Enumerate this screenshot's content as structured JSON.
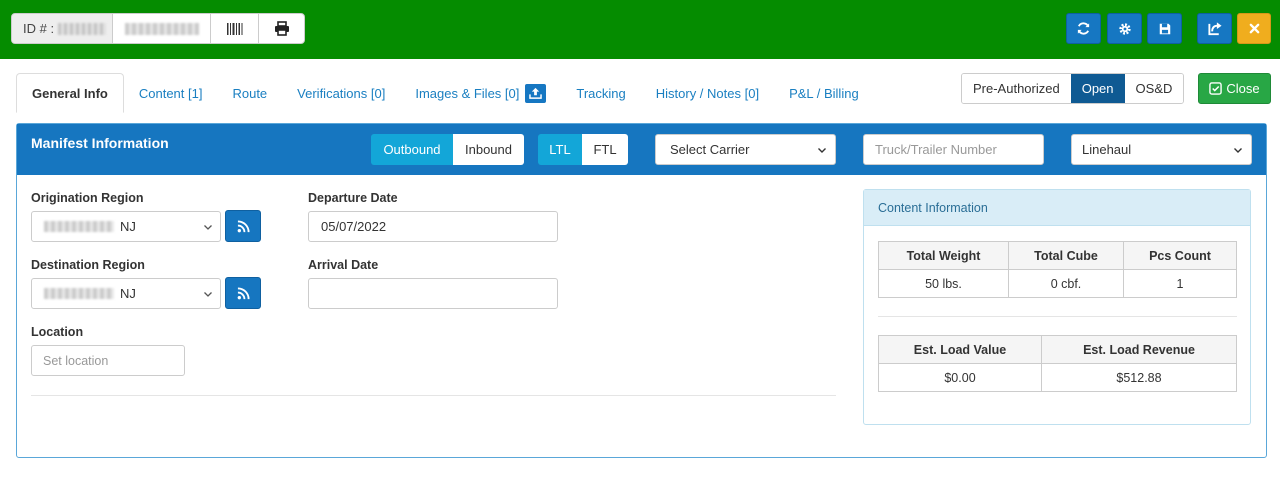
{
  "header": {
    "id_label": "ID # :",
    "buttons": [
      "refresh-icon",
      "gear-icon",
      "save-icon",
      "share-icon",
      "close-icon"
    ]
  },
  "tabs": [
    {
      "label": "General Info",
      "active": true
    },
    {
      "label": "Content [1]"
    },
    {
      "label": "Route"
    },
    {
      "label": "Verifications [0]"
    },
    {
      "label": "Images & Files [0]"
    },
    {
      "label": "Tracking"
    },
    {
      "label": "History / Notes [0]"
    },
    {
      "label": "P&L / Billing"
    }
  ],
  "status": {
    "options": [
      "Pre-Authorized",
      "Open",
      "OS&D"
    ],
    "selected": "Open",
    "close_label": "Close"
  },
  "manifest": {
    "title": "Manifest Information",
    "direction": {
      "options": [
        "Outbound",
        "Inbound"
      ],
      "selected": "Outbound"
    },
    "load_type": {
      "options": [
        "LTL",
        "FTL"
      ],
      "selected": "LTL"
    },
    "carrier": "Select Carrier",
    "truck_placeholder": "Truck/Trailer Number",
    "route_type": "Linehaul"
  },
  "form": {
    "origination_label": "Origination Region",
    "origination_suffix": "NJ",
    "destination_label": "Destination Region",
    "destination_suffix": "NJ",
    "location_label": "Location",
    "location_placeholder": "Set location",
    "departure_label": "Departure Date",
    "departure_value": "05/07/2022",
    "arrival_label": "Arrival Date",
    "arrival_value": ""
  },
  "content_info": {
    "title": "Content Information",
    "table1": {
      "headers": [
        "Total Weight",
        "Total Cube",
        "Pcs Count"
      ],
      "values": [
        "50 lbs.",
        "0 cbf.",
        "1"
      ]
    },
    "table2": {
      "headers": [
        "Est. Load Value",
        "Est. Load Revenue"
      ],
      "values": [
        "$0.00",
        "$512.88"
      ]
    }
  }
}
